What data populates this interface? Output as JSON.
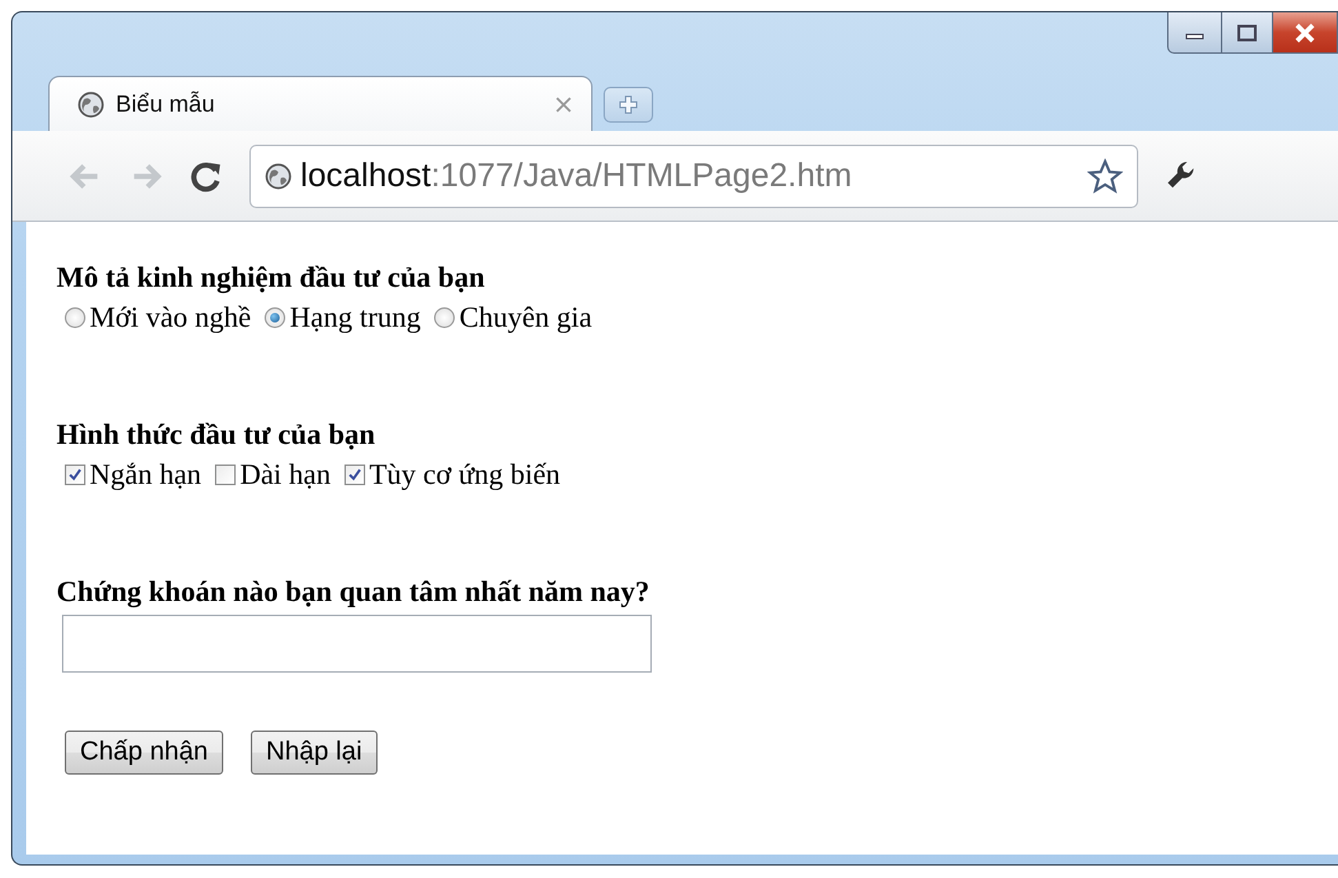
{
  "tab": {
    "title": "Biểu mẫu"
  },
  "address_bar": {
    "host": "localhost",
    "path": ":1077/Java/HTMLPage2.htm"
  },
  "sections": [
    {
      "kind": "radio",
      "heading": "Mô tả kinh nghiệm đầu tư của bạn",
      "options": [
        {
          "label": "Mới vào nghề",
          "selected": false
        },
        {
          "label": "Hạng trung",
          "selected": true
        },
        {
          "label": "Chuyên gia",
          "selected": false
        }
      ]
    },
    {
      "kind": "checkbox",
      "heading": "Hình thức đầu tư của bạn",
      "options": [
        {
          "label": "Ngắn hạn",
          "checked": true
        },
        {
          "label": "Dài hạn",
          "checked": false
        },
        {
          "label": "Tùy cơ ứng biến",
          "checked": true
        }
      ]
    },
    {
      "kind": "text",
      "heading": "Chứng khoán nào bạn quan tâm nhất năm nay?"
    }
  ],
  "buttons": [
    "Chấp nhận",
    "Nhập lại"
  ]
}
